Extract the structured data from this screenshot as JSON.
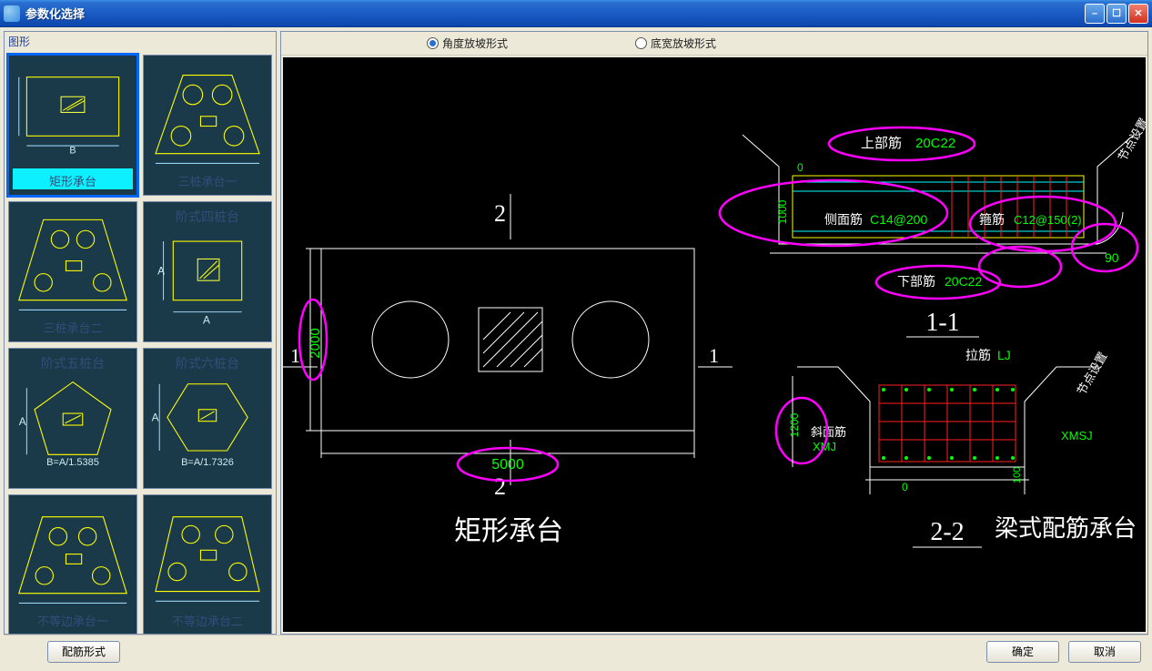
{
  "window": {
    "title": "参数化选择"
  },
  "left": {
    "caption": "图形",
    "thumbs": [
      {
        "label": "矩形承台",
        "selected": true
      },
      {
        "label": "三桩承台一"
      },
      {
        "label": "三桩承台二"
      },
      {
        "title": "阶式四桩台",
        "axis_a": "A",
        "axis_b": "A"
      },
      {
        "title": "阶式五桩台",
        "formula": "B=A/1.5385",
        "axis_a": "A"
      },
      {
        "title": "阶式六桩台",
        "formula": "B=A/1.7326",
        "axis_a": "A"
      },
      {
        "label": "不等边承台一"
      },
      {
        "label": "不等边承台二"
      }
    ]
  },
  "options": {
    "radio1": "角度放坡形式",
    "radio2": "底宽放坡形式"
  },
  "drawing": {
    "plan": {
      "title": "矩形承台",
      "section_top": "2",
      "section_bottom": "2",
      "section_left": "1",
      "section_right": "1",
      "width": "5000",
      "height": "2000"
    },
    "sec11": {
      "label": "1-1",
      "top_bar_label": "上部筋",
      "top_bar_value": "20C22",
      "side_bar_label": "侧面筋",
      "side_bar_value": "C14@200",
      "stirrup_label": "箍筋",
      "stirrup_value": "C12@150(2)",
      "bottom_bar_label": "下部筋",
      "bottom_bar_value": "20C22",
      "angle": "90",
      "dim_h": "1000",
      "dim_zero": "0",
      "note_right": "节点设置"
    },
    "sec22": {
      "label": "2-2",
      "title_right": "梁式配筋承台",
      "tie_label": "拉筋",
      "tie_value": "LJ",
      "slope_label": "斜面筋",
      "xmj": "XMJ",
      "xmsj": "XMSJ",
      "dim_v": "1200",
      "dim_zero": "0",
      "dim_leg": "100",
      "note_right": "节点设置"
    }
  },
  "buttons": {
    "rebar_style": "配筋形式",
    "ok": "确定",
    "cancel": "取消"
  }
}
